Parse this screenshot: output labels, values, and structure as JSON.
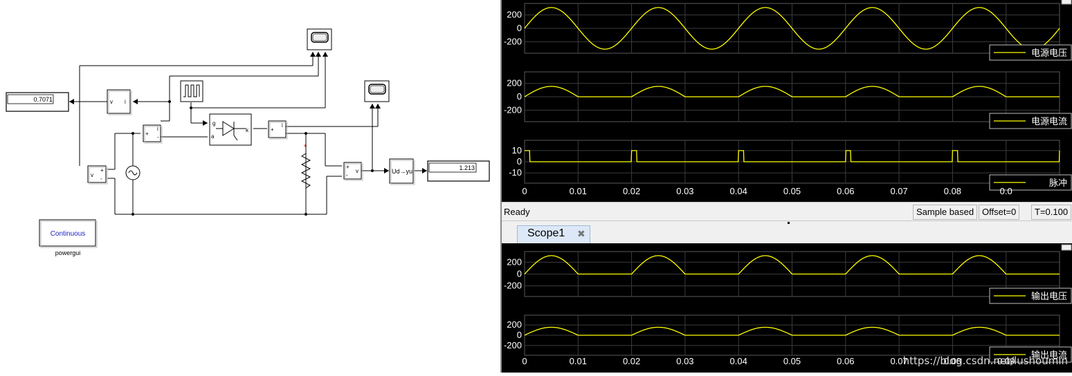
{
  "model": {
    "display_rms_value": "0.7071",
    "display_avg_value": "1.213",
    "powergui_label": "powergui",
    "powergui_mode": "Continuous",
    "vmeas_label": "v",
    "imeas_label": "i",
    "thyristor_ports": {
      "g": "g",
      "a": "a",
      "k": "k"
    },
    "avg_block_label": "Ud→yu",
    "plus": "+",
    "minus": "-"
  },
  "scope_top": {
    "axes": [
      {
        "legend": "电源电压",
        "yticks": [
          "200",
          "0",
          "-200"
        ]
      },
      {
        "legend": "电源电流",
        "yticks": [
          "200",
          "0",
          "-200"
        ]
      },
      {
        "legend": "脉冲",
        "yticks": [
          "10",
          "0",
          "-10"
        ]
      }
    ],
    "xticks": [
      "0",
      "0.01",
      "0.02",
      "0.03",
      "0.04",
      "0.05",
      "0.06",
      "0.07",
      "0.08",
      "0.0"
    ],
    "status": {
      "ready": "Ready",
      "sample": "Sample based",
      "offset": "Offset=0",
      "time": "T=0.100"
    }
  },
  "scope_bottom": {
    "tab_label": "Scope1",
    "tab_close": "✖",
    "axes": [
      {
        "legend": "输出电压",
        "yticks": [
          "200",
          "0",
          "-200"
        ]
      },
      {
        "legend": "输出电流",
        "yticks": [
          "200",
          "0",
          "-200"
        ]
      }
    ],
    "xticks": [
      "0",
      "0.01",
      "0.02",
      "0.03",
      "0.04",
      "0.05",
      "0.06",
      "0.07",
      "0.08",
      "0.09"
    ]
  },
  "watermark": "https://blog.csdn.net/lushoumin",
  "colors": {
    "trace": "#ffff00",
    "scope_bg": "#000000",
    "grid": "#3c3c3c"
  }
}
